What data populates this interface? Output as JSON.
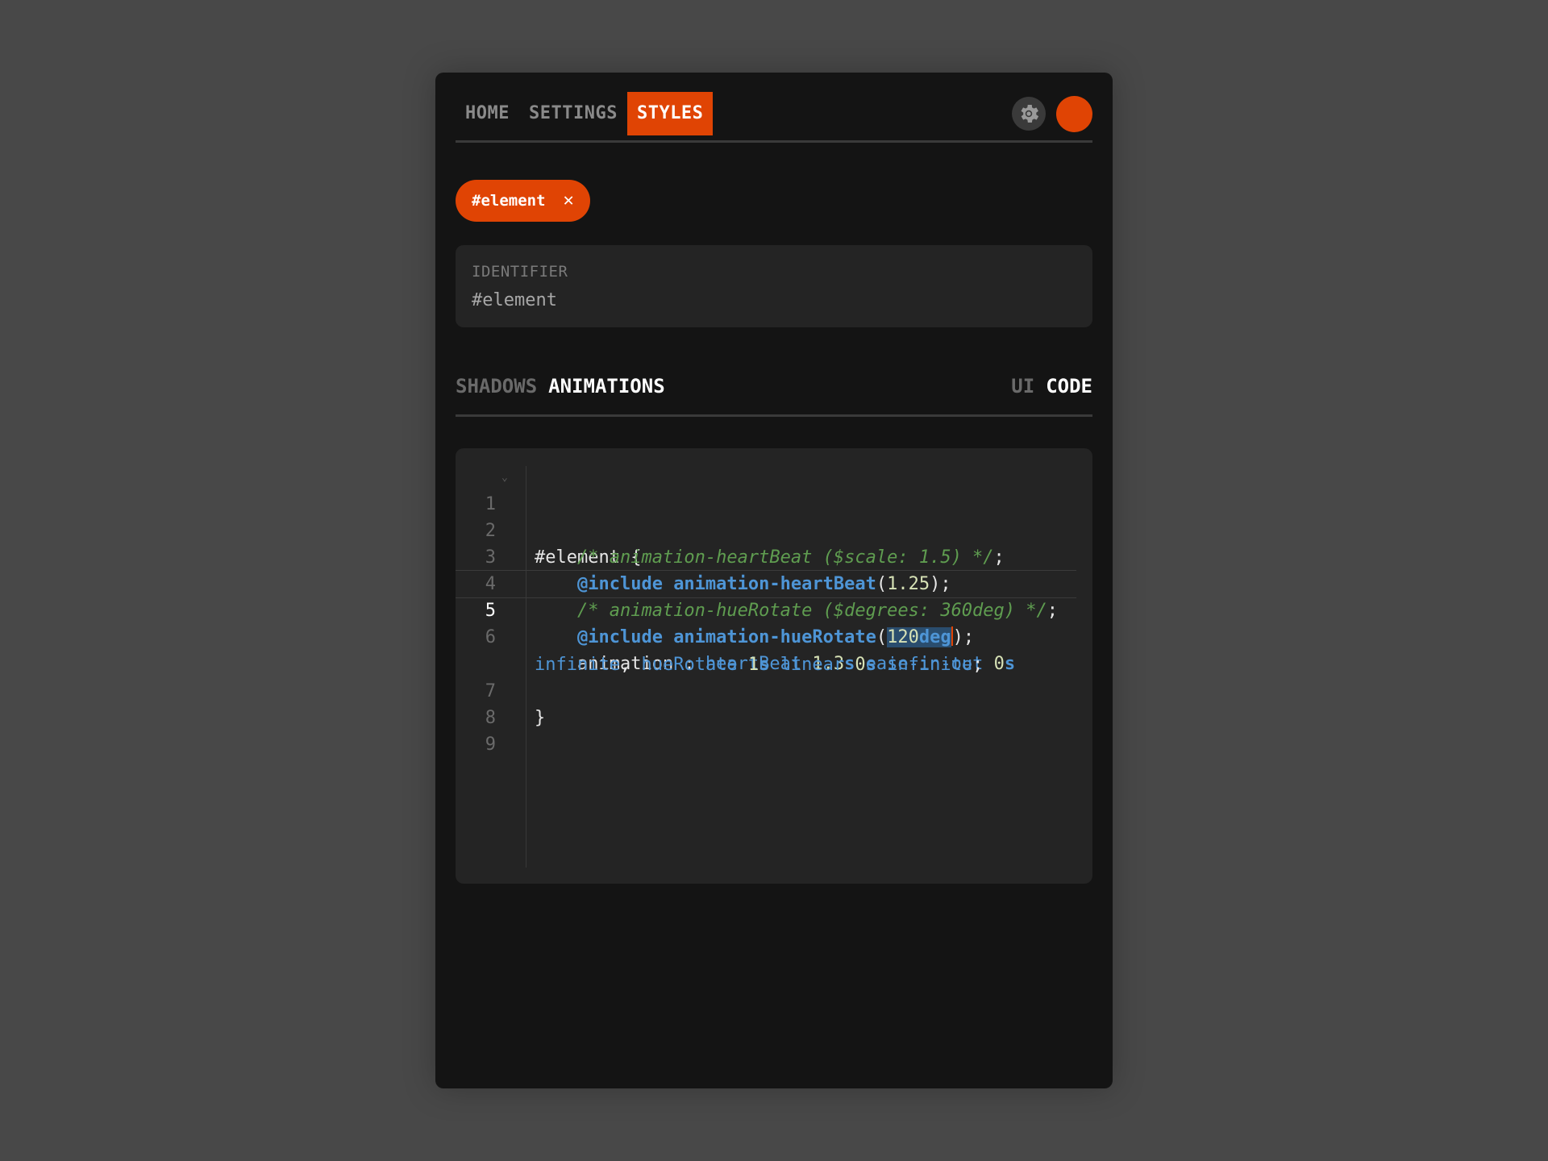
{
  "nav": {
    "tabs": [
      {
        "label": "HOME"
      },
      {
        "label": "SETTINGS"
      },
      {
        "label": "STYLES"
      }
    ],
    "active_tab": "STYLES"
  },
  "chip": {
    "label": "#element",
    "close_glyph": "✕"
  },
  "identifier": {
    "label": "IDENTIFIER",
    "value": "#element"
  },
  "section_tabs": {
    "left": [
      {
        "label": "SHADOWS"
      },
      {
        "label": "ANIMATIONS"
      }
    ],
    "right": [
      {
        "label": "UI"
      },
      {
        "label": "CODE"
      }
    ]
  },
  "editor": {
    "line_numbers": [
      "1",
      "2",
      "3",
      "4",
      "5",
      "6",
      "7",
      "8",
      "9"
    ],
    "current_line": "5",
    "lines": {
      "l1": "#element {",
      "l2_comment": "/* animation-heartBeat ($scale: 1.5) */",
      "l2_end": ";",
      "l3_kw": "@include animation-heartBeat",
      "l3_open": "(",
      "l3_arg": "1.25",
      "l3_close": ");",
      "l4_comment": "/* animation-hueRotate ($degrees: 360deg) */",
      "l4_end": ";",
      "l5_kw": "@include animation-hueRotate",
      "l5_open": "(",
      "l5_sel_num": "120",
      "l5_sel_unit": "deg",
      "l5_close": ");",
      "l6_prop": "animation : ",
      "l6_v1": "heartBeat",
      "l6_n1": "1.3",
      "l6_u1": "s",
      "l6_v2": "ease-in-out",
      "l6_n2": "0",
      "l6_u2": "s",
      "l6b_v1": "infinite",
      "l6b_comma": ", ",
      "l6b_v2": "hueRotate",
      "l6b_n1": "1",
      "l6b_u1": "s",
      "l6b_v3": "linear",
      "l6b_n2": "0",
      "l6b_u2": "s",
      "l6b_v4": "infinite",
      "l6b_end": ";",
      "l7": "}"
    }
  },
  "colors": {
    "accent": "#e04404",
    "background": "#484848",
    "panel": "#141414",
    "comment": "#5f9d50",
    "keyword": "#4e95d6"
  },
  "icons": {
    "settings": "gear-icon",
    "chip_close": "close-icon",
    "fold": "chevron-down-icon"
  }
}
